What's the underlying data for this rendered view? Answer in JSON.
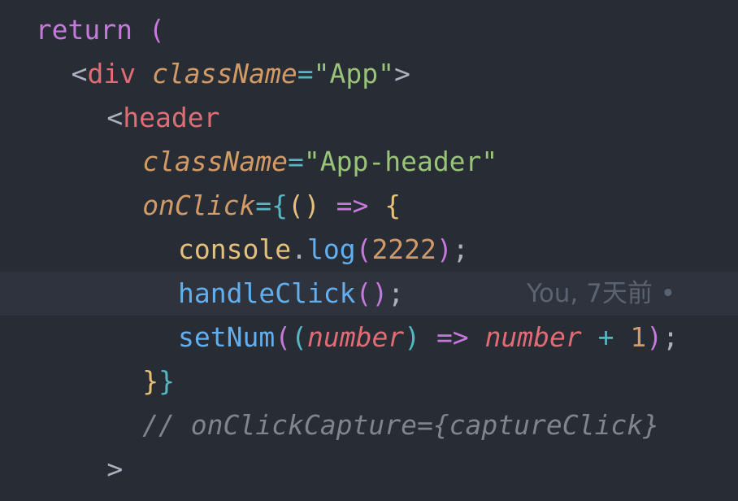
{
  "editor": {
    "lines": [
      {
        "indent": 2,
        "tokens": [
          {
            "t": "return",
            "c": "kw"
          },
          {
            "t": " ",
            "c": "punct"
          },
          {
            "t": "(",
            "c": "brace2"
          }
        ]
      },
      {
        "indent": 4,
        "tokens": [
          {
            "t": "<",
            "c": "punct"
          },
          {
            "t": "div",
            "c": "tag"
          },
          {
            "t": " ",
            "c": "punct"
          },
          {
            "t": "className",
            "c": "attr"
          },
          {
            "t": "=",
            "c": "op"
          },
          {
            "t": "\"App\"",
            "c": "str"
          },
          {
            "t": ">",
            "c": "punct"
          }
        ]
      },
      {
        "indent": 6,
        "tokens": [
          {
            "t": "<",
            "c": "punct"
          },
          {
            "t": "header",
            "c": "tag"
          }
        ]
      },
      {
        "indent": 8,
        "tokens": [
          {
            "t": "className",
            "c": "attr"
          },
          {
            "t": "=",
            "c": "op"
          },
          {
            "t": "\"App-header\"",
            "c": "str"
          }
        ]
      },
      {
        "indent": 8,
        "tokens": [
          {
            "t": "onClick",
            "c": "attr"
          },
          {
            "t": "=",
            "c": "op"
          },
          {
            "t": "{",
            "c": "brace3"
          },
          {
            "t": "(",
            "c": "brace1"
          },
          {
            "t": ")",
            "c": "brace1"
          },
          {
            "t": " ",
            "c": "punct"
          },
          {
            "t": "=>",
            "c": "kw"
          },
          {
            "t": " ",
            "c": "punct"
          },
          {
            "t": "{",
            "c": "brace1"
          }
        ]
      },
      {
        "indent": 10,
        "tokens": [
          {
            "t": "console",
            "c": "obj"
          },
          {
            "t": ".",
            "c": "punct"
          },
          {
            "t": "log",
            "c": "fn"
          },
          {
            "t": "(",
            "c": "brace2"
          },
          {
            "t": "2222",
            "c": "num"
          },
          {
            "t": ")",
            "c": "brace2"
          },
          {
            "t": ";",
            "c": "punct"
          }
        ]
      },
      {
        "indent": 10,
        "current": true,
        "tokens": [
          {
            "t": "handleClick",
            "c": "fn"
          },
          {
            "t": "(",
            "c": "brace2"
          },
          {
            "t": ")",
            "c": "brace2"
          },
          {
            "t": ";",
            "c": "punct"
          }
        ]
      },
      {
        "indent": 10,
        "tokens": [
          {
            "t": "setNum",
            "c": "fn"
          },
          {
            "t": "(",
            "c": "brace2"
          },
          {
            "t": "(",
            "c": "brace3"
          },
          {
            "t": "number",
            "c": "param"
          },
          {
            "t": ")",
            "c": "brace3"
          },
          {
            "t": " ",
            "c": "punct"
          },
          {
            "t": "=>",
            "c": "kw"
          },
          {
            "t": " ",
            "c": "punct"
          },
          {
            "t": "number",
            "c": "param"
          },
          {
            "t": " ",
            "c": "punct"
          },
          {
            "t": "+",
            "c": "op"
          },
          {
            "t": " ",
            "c": "punct"
          },
          {
            "t": "1",
            "c": "num"
          },
          {
            "t": ")",
            "c": "brace2"
          },
          {
            "t": ";",
            "c": "punct"
          }
        ]
      },
      {
        "indent": 8,
        "tokens": [
          {
            "t": "}",
            "c": "brace1"
          },
          {
            "t": "}",
            "c": "brace3"
          }
        ]
      },
      {
        "indent": 8,
        "tokens": [
          {
            "t": "// onClickCapture={captureClick}",
            "c": "comment"
          }
        ]
      },
      {
        "indent": 6,
        "tokens": [
          {
            "t": ">",
            "c": "punct"
          }
        ]
      }
    ],
    "blame": "You, 7天前 •"
  }
}
